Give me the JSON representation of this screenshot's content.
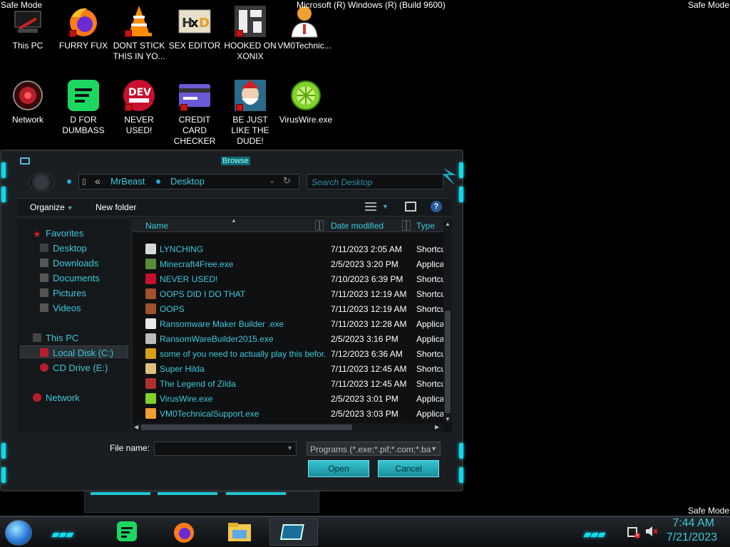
{
  "system": {
    "safe_mode_tl": "Safe Mode",
    "safe_mode_tr": "Safe Mode",
    "safe_mode_br": "Safe Mode",
    "build": "Microsoft (R) Windows (R) (Build 9600)"
  },
  "desktop_icons": [
    {
      "label": "This PC",
      "icon": "computer-icon"
    },
    {
      "label": "FURRY FUX",
      "icon": "firefox-icon"
    },
    {
      "label": "DONT STICK THIS IN YO...",
      "icon": "vlc-cone-icon"
    },
    {
      "label": "SEX EDITOR",
      "icon": "hxd-icon"
    },
    {
      "label": "HOOKED ON XONIX",
      "icon": "game-icon"
    },
    {
      "label": "VM0Technic...",
      "icon": "support-person-icon"
    },
    {
      "label": "Network",
      "icon": "network-icon"
    },
    {
      "label": "D FOR DUMBASS",
      "icon": "spotify-icon"
    },
    {
      "label": "NEVER USED!",
      "icon": "dev-icon"
    },
    {
      "label": "CREDIT CARD CHECKER",
      "icon": "credit-card-icon"
    },
    {
      "label": "BE JUST LIKE THE DUDE!",
      "icon": "santa-icon"
    },
    {
      "label": "VirusWire.exe",
      "icon": "limewire-icon"
    }
  ],
  "window": {
    "title": "Browse",
    "address": {
      "crumb1": "MrBeast",
      "crumb2": "Desktop",
      "back": "«"
    },
    "search_placeholder": "Search Desktop",
    "toolbar": {
      "organize": "Organize",
      "new_folder": "New folder",
      "help": "?"
    },
    "nav": {
      "favorites": "Favorites",
      "desktop": "Desktop",
      "downloads": "Downloads",
      "documents": "Documents",
      "pictures": "Pictures",
      "videos": "Videos",
      "this_pc": "This PC",
      "local_disk": "Local Disk (C:)",
      "cd_drive": "CD Drive (E:)",
      "network": "Network"
    },
    "columns": {
      "name": "Name",
      "date": "Date modified",
      "type": "Type"
    },
    "files": [
      {
        "name": "LYNCHING",
        "date": "7/11/2023 2:05 AM",
        "type": "Shortcut",
        "color": "#d9d9d9"
      },
      {
        "name": "Minecraft4Free.exe",
        "date": "2/5/2023 3:20 PM",
        "type": "Application",
        "color": "#5a8a3a"
      },
      {
        "name": "NEVER USED!",
        "date": "7/10/2023 6:39 PM",
        "type": "Shortcut",
        "color": "#c8102e"
      },
      {
        "name": "OOPS DID I DO THAT",
        "date": "7/11/2023 12:19 AM",
        "type": "Shortcut",
        "color": "#a0522d"
      },
      {
        "name": "OOPS",
        "date": "7/11/2023 12:19 AM",
        "type": "Shortcut",
        "color": "#a0522d"
      },
      {
        "name": "Ransomware Maker Builder .exe",
        "date": "7/11/2023 12:28 AM",
        "type": "Application",
        "color": "#e8e8e8"
      },
      {
        "name": "RansomWareBuilder2015.exe",
        "date": "2/5/2023 3:16 PM",
        "type": "Application",
        "color": "#bbbbbb"
      },
      {
        "name": "some of you need to actually play this befor...",
        "date": "7/12/2023 6:36 AM",
        "type": "Shortcut",
        "color": "#d4a017"
      },
      {
        "name": "Super Hilda",
        "date": "7/11/2023 12:45 AM",
        "type": "Shortcut",
        "color": "#e0c080"
      },
      {
        "name": "The Legend of Zilda",
        "date": "7/11/2023 12:45 AM",
        "type": "Shortcut",
        "color": "#b03030"
      },
      {
        "name": "VirusWire.exe",
        "date": "2/5/2023 3:01 PM",
        "type": "Application",
        "color": "#7fd32a"
      },
      {
        "name": "VM0TechnicalSupport.exe",
        "date": "2/5/2023 3:03 PM",
        "type": "Application",
        "color": "#f0a030"
      }
    ],
    "file_name_label": "File name:",
    "file_name_value": "",
    "filter": "Programs (*.exe;*.pif;*.com;*.ba",
    "open_button": "Open",
    "cancel_button": "Cancel"
  },
  "taskbar": {
    "time": "7:44 AM",
    "date": "7/21/2023",
    "apps": [
      "spotify-icon",
      "firefox-icon",
      "file-explorer-icon",
      "browse-window-icon"
    ]
  },
  "colors": {
    "accent": "#3ec8dc",
    "button": "#1fb4c4"
  }
}
